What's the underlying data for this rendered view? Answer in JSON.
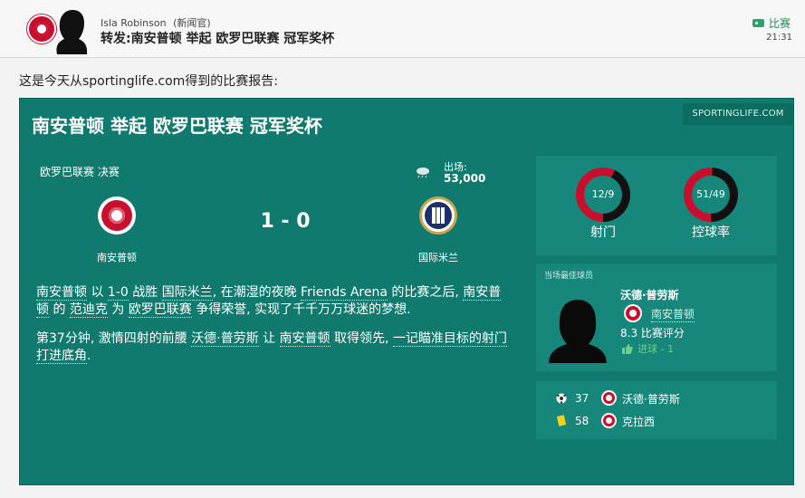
{
  "header": {
    "sender": "Isla Robinson",
    "sender_tag": "(新闻官)",
    "subject": "转发:南安普顿 举起 欧罗巴联赛 冠军奖杯",
    "category": "比赛",
    "time": "21:31"
  },
  "intro": "这是今天从sportinglife.com得到的比赛报告:",
  "card": {
    "source": "SPORTINGLIFE.COM",
    "title": "南安普顿 举起 欧罗巴联赛 冠军奖杯",
    "competition": "欧罗巴联赛 决赛",
    "home_team": "南安普顿",
    "away_team": "国际米兰",
    "score": "1 - 0",
    "attendance_label": "出场:",
    "attendance_value": "53,000",
    "weather_icon": "rain-cloud-icon",
    "report": {
      "p1": [
        {
          "t": "南安普顿",
          "link": true
        },
        {
          "t": " 以 ",
          "link": false
        },
        {
          "t": "1-0",
          "link": true
        },
        {
          "t": " 战胜 ",
          "link": false
        },
        {
          "t": "国际米兰",
          "link": true
        },
        {
          "t": ", 在潮湿的夜晚 ",
          "link": false
        },
        {
          "t": "Friends Arena",
          "link": true
        },
        {
          "t": " 的比赛之后, ",
          "link": false
        },
        {
          "t": "南安普顿",
          "link": true
        },
        {
          "t": " 的 ",
          "link": false
        },
        {
          "t": "范迪克",
          "link": true
        },
        {
          "t": " 为 ",
          "link": false
        },
        {
          "t": "欧罗巴联赛",
          "link": true
        },
        {
          "t": " 争得荣誉, 实现了千千万万球迷的梦想.",
          "link": false
        }
      ],
      "p2": [
        {
          "t": "第37分钟, 激情四射的前腰 ",
          "link": false
        },
        {
          "t": "沃德·普劳斯",
          "link": true
        },
        {
          "t": " 让 ",
          "link": false
        },
        {
          "t": "南安普顿",
          "link": true
        },
        {
          "t": " 取得领先, ",
          "link": false
        },
        {
          "t": "一记瞄准目标的射门打进底角",
          "link": true
        },
        {
          "t": ".",
          "link": false
        }
      ]
    }
  },
  "stats": {
    "shots": {
      "label": "射门",
      "text": "12/9",
      "home": 12,
      "away": 9
    },
    "possession": {
      "label": "控球率",
      "text": "51/49",
      "home": 51,
      "away": 49
    },
    "colors": {
      "home": "#c8102e",
      "away": "#111111"
    }
  },
  "player_of_match": {
    "heading": "当场最佳球员",
    "name": "沃德·普劳斯",
    "team": "南安普顿",
    "rating": "8.3 比赛评分",
    "goals": "进球 - 1"
  },
  "events": [
    {
      "icon": "football-goal-icon",
      "minute": "37",
      "player": "沃德·普劳斯"
    },
    {
      "icon": "yellow-card-icon",
      "minute": "58",
      "player": "克拉西"
    }
  ]
}
